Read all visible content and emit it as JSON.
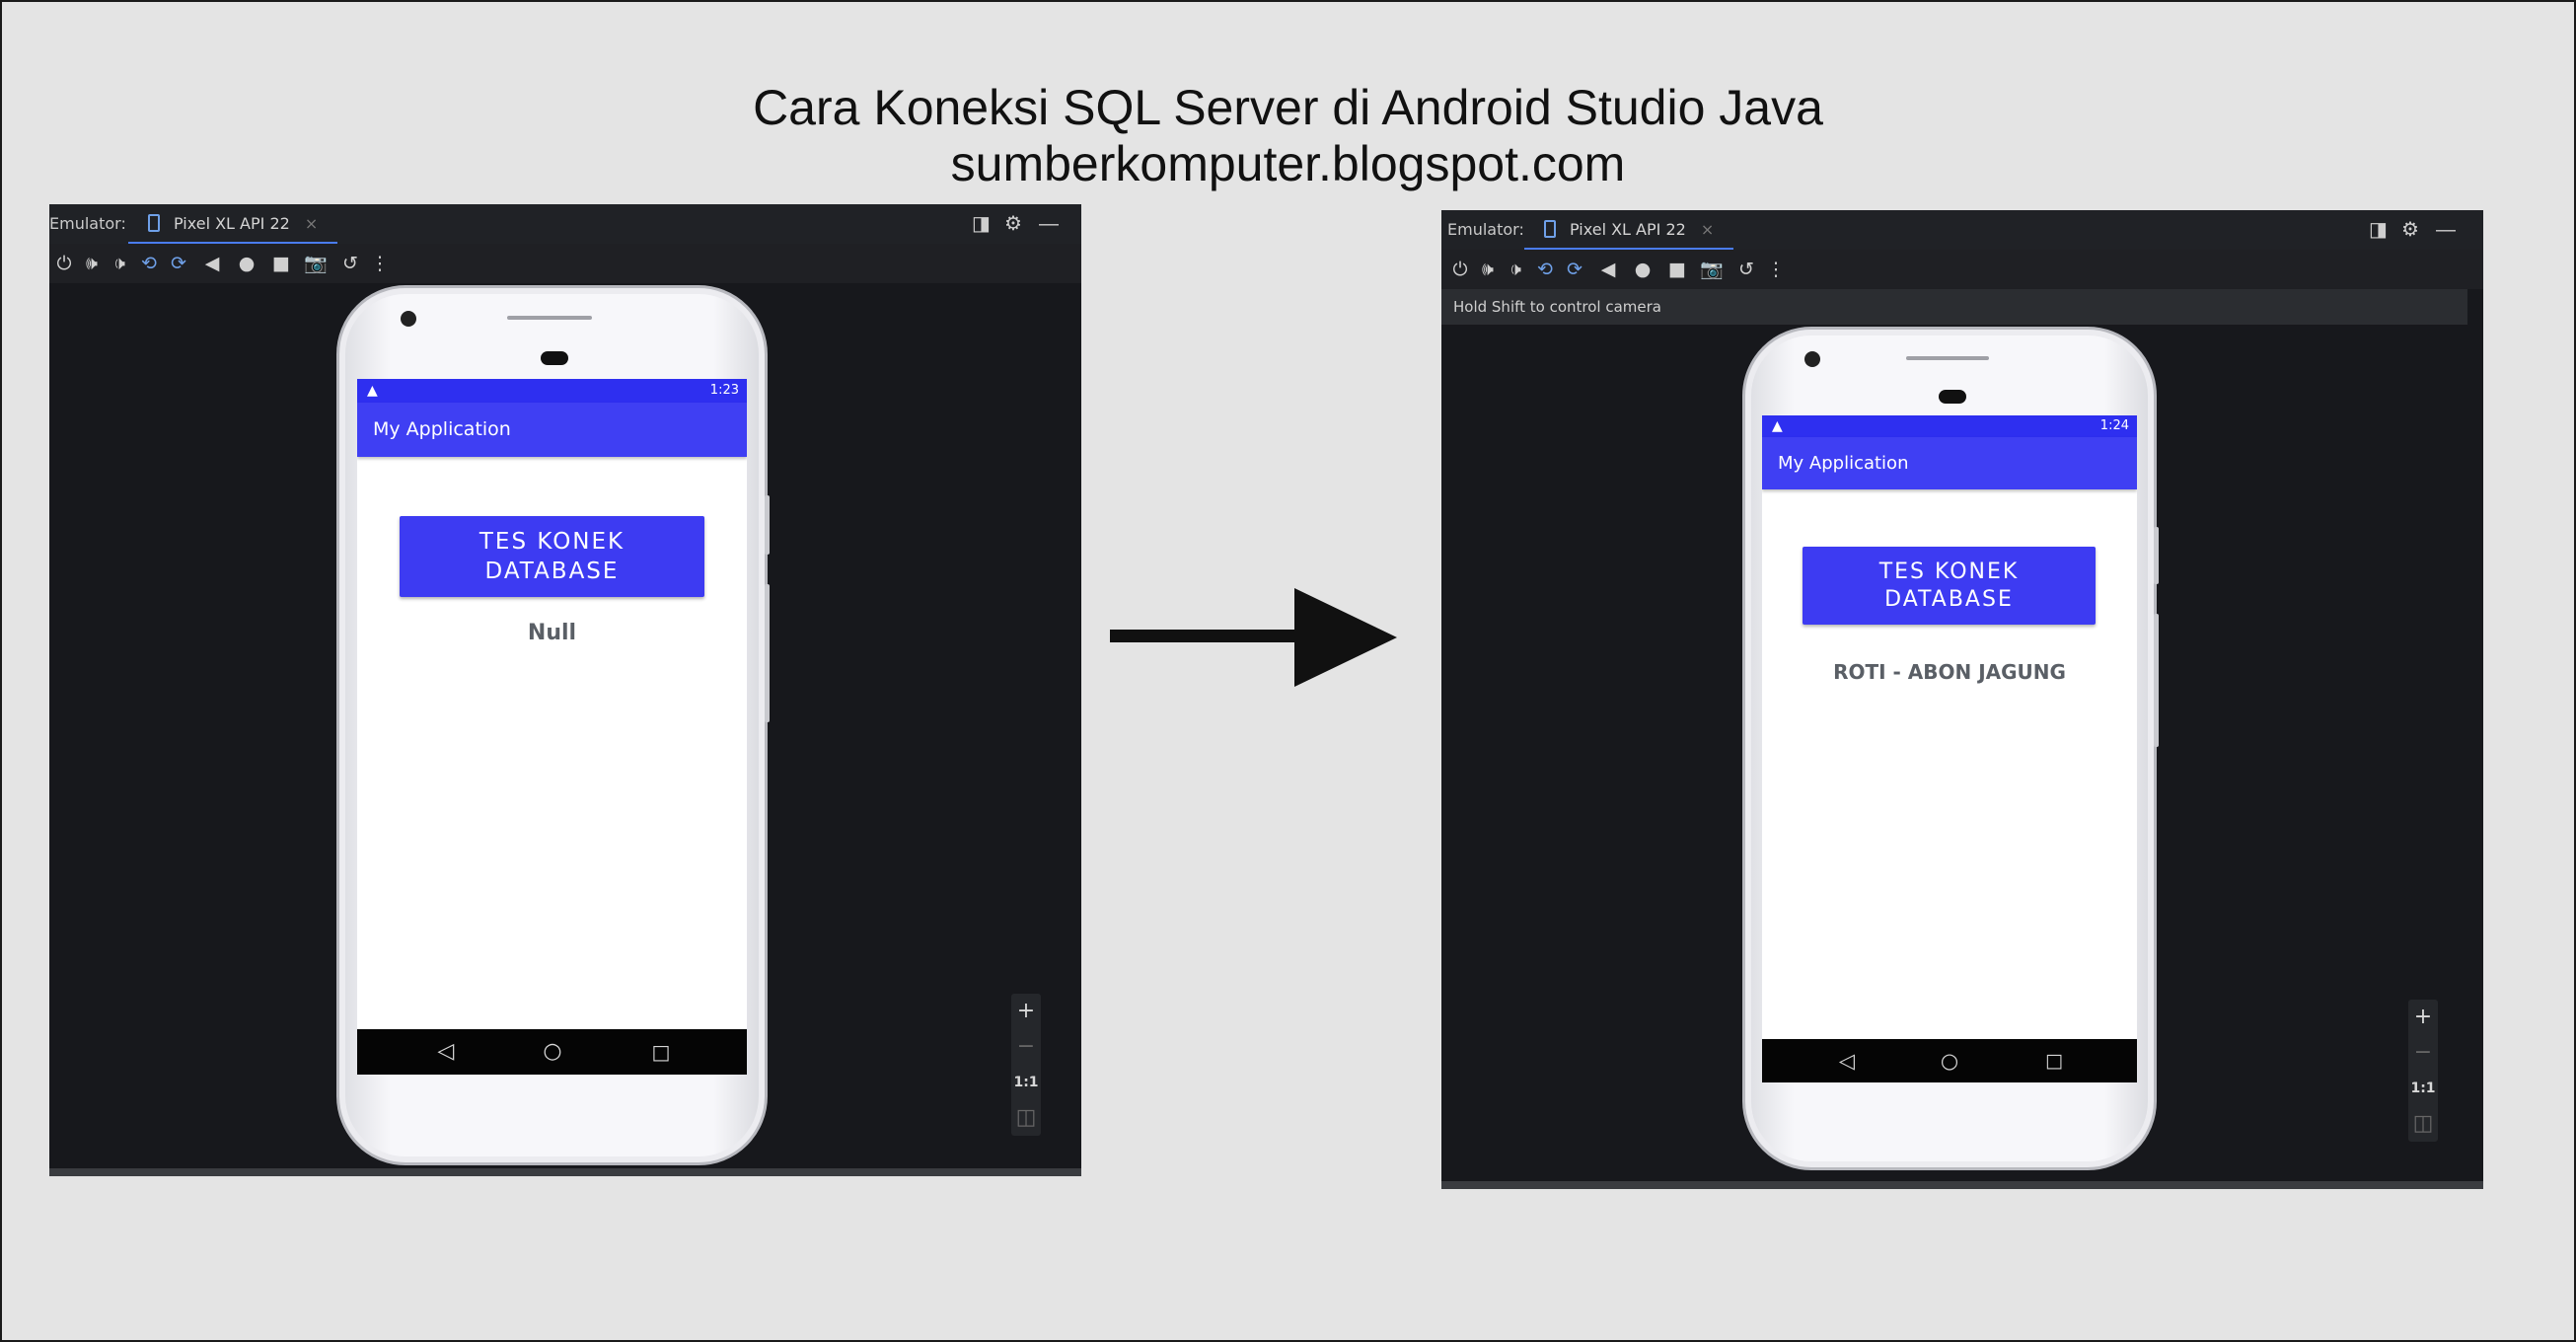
{
  "header": {
    "title": "Cara Koneksi SQL Server di Android Studio Java",
    "subtitle": "sumberkomputer.blogspot.com"
  },
  "emulator_left": {
    "label": "Emulator:",
    "tab_name": "Pixel XL API 22",
    "tab_close": "×",
    "toolbar_icons": [
      "power-icon",
      "volume-up-icon",
      "volume-down-icon",
      "rotate-left-icon",
      "rotate-right-icon",
      "back-icon",
      "home-icon",
      "overview-icon",
      "screenshot-icon",
      "undo-icon",
      "more-icon"
    ],
    "zoom_controls": {
      "zoom_in": "+",
      "zoom_out": "−",
      "one_to_one": "1:1"
    },
    "phone": {
      "status_time": "1:23",
      "app_title": "My Application",
      "button_label": "TES KONEK DATABASE",
      "result_text": "Null"
    }
  },
  "emulator_right": {
    "label": "Emulator:",
    "tab_name": "Pixel XL API 22",
    "tab_close": "×",
    "hint": "Hold Shift to control camera",
    "zoom_controls": {
      "zoom_in": "+",
      "zoom_out": "−",
      "one_to_one": "1:1"
    },
    "phone": {
      "status_time": "1:24",
      "app_title": "My Application",
      "button_label": "TES KONEK DATABASE",
      "result_text": "ROTI - ABON JAGUNG"
    }
  },
  "colors": {
    "accent": "#3d3bf2",
    "status_bar": "#2e2ff0",
    "emulator_bg": "#17181c",
    "page_bg": "#e4e4e4"
  }
}
